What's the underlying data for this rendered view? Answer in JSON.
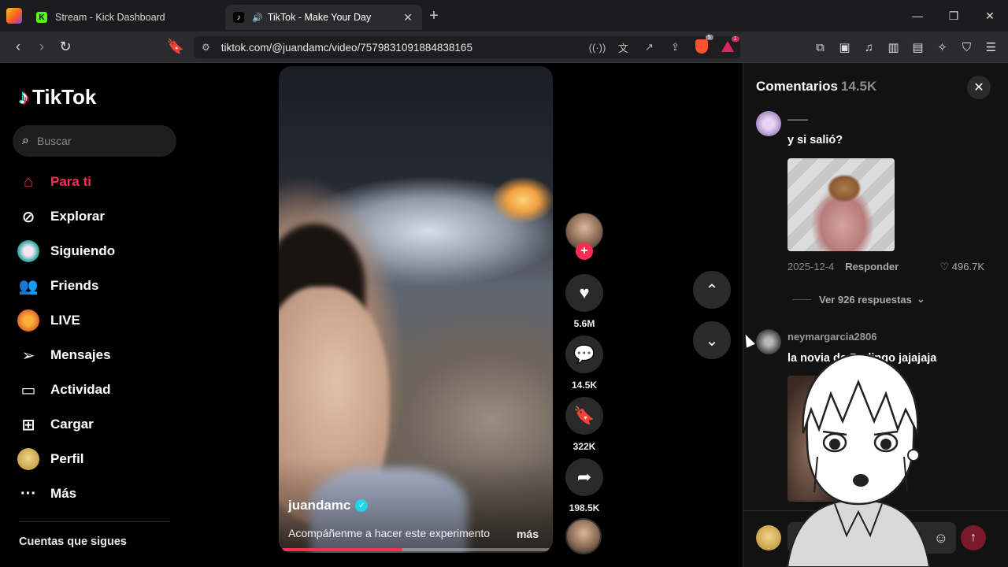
{
  "browser": {
    "tabs": [
      {
        "title": "Stream - Kick Dashboard",
        "favicon": "kick-icon",
        "active": false
      },
      {
        "title": "TikTok - Make Your Day",
        "favicon": "tiktok-icon",
        "active": true
      }
    ],
    "url": "tiktok.com/@juandamc/video/7579831091884838165",
    "brave_badge": "5",
    "rewards_badge": "1"
  },
  "sidebar": {
    "logo": "TikTok",
    "search_placeholder": "Buscar",
    "items": [
      {
        "label": "Para ti",
        "icon": "home-icon",
        "active": true
      },
      {
        "label": "Explorar",
        "icon": "compass-icon"
      },
      {
        "label": "Siguiendo",
        "icon": "following-avatar-icon"
      },
      {
        "label": "Friends",
        "icon": "friends-icon"
      },
      {
        "label": "LIVE",
        "icon": "live-icon"
      },
      {
        "label": "Mensajes",
        "icon": "send-icon"
      },
      {
        "label": "Actividad",
        "icon": "activity-icon"
      },
      {
        "label": "Cargar",
        "icon": "upload-icon"
      },
      {
        "label": "Perfil",
        "icon": "profile-avatar-icon"
      },
      {
        "label": "Más",
        "icon": "more-icon"
      }
    ],
    "following_heading": "Cuentas que sigues"
  },
  "video": {
    "author": "juandamc",
    "description": "Acompáñenme a hacer este experimento",
    "more_label": "más",
    "progress": 0.45
  },
  "actions": {
    "likes": "5.6M",
    "comments": "14.5K",
    "saves": "322K",
    "shares": "198.5K"
  },
  "comments_panel": {
    "title": "Comentarios",
    "count": "14.5K",
    "comments": [
      {
        "user": "——",
        "text": "y si salió?",
        "date": "2025-12-4",
        "reply_label": "Responder",
        "likes": "496.7K",
        "replies_label": "Ver 926 respuestas"
      },
      {
        "user": "neymargarcia2806",
        "text": "la novia de Pudingo jajajaja"
      }
    ],
    "input_placeholder": "A"
  },
  "colors": {
    "accent": "#fe2c55",
    "verified": "#20d5ec",
    "panel_bg": "#121212"
  }
}
